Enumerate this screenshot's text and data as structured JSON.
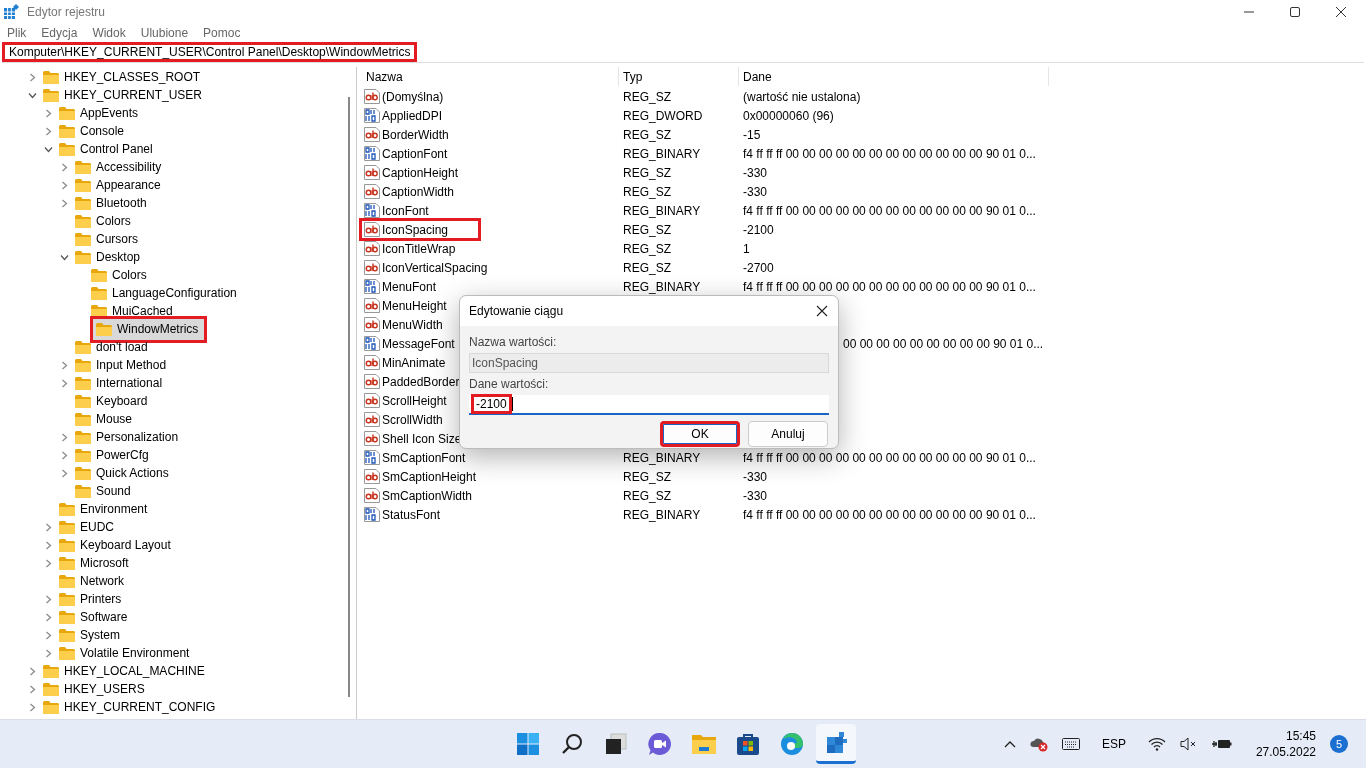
{
  "window": {
    "title": "Edytor rejestru"
  },
  "menu": [
    "Plik",
    "Edycja",
    "Widok",
    "Ulubione",
    "Pomoc"
  ],
  "address": {
    "value": "Komputer\\HKEY_CURRENT_USER\\Control Panel\\Desktop\\WindowMetrics",
    "annotated": true
  },
  "tree": [
    {
      "label": "HKEY_CLASSES_ROOT",
      "expanded": false,
      "selected": false
    },
    {
      "label": "HKEY_CURRENT_USER",
      "expanded": true,
      "selected": false,
      "children": [
        {
          "label": "AppEvents",
          "expanded": false,
          "selected": false
        },
        {
          "label": "Console",
          "expanded": false,
          "selected": false
        },
        {
          "label": "Control Panel",
          "expanded": true,
          "selected": false,
          "children": [
            {
              "label": "Accessibility",
              "expanded": false,
              "selected": false
            },
            {
              "label": "Appearance",
              "expanded": false,
              "selected": false
            },
            {
              "label": "Bluetooth",
              "expanded": false,
              "selected": false
            },
            {
              "label": "Colors",
              "selected": false
            },
            {
              "label": "Cursors",
              "selected": false
            },
            {
              "label": "Desktop",
              "expanded": true,
              "selected": false,
              "children": [
                {
                  "label": "Colors",
                  "selected": false
                },
                {
                  "label": "LanguageConfiguration",
                  "selected": false
                },
                {
                  "label": "MuiCached",
                  "selected": false
                },
                {
                  "label": "WindowMetrics",
                  "selected": true,
                  "annotated": true
                }
              ]
            },
            {
              "label": "don't load",
              "selected": false
            },
            {
              "label": "Input Method",
              "expanded": false,
              "selected": false
            },
            {
              "label": "International",
              "expanded": false,
              "selected": false
            },
            {
              "label": "Keyboard",
              "selected": false
            },
            {
              "label": "Mouse",
              "selected": false
            },
            {
              "label": "Personalization",
              "expanded": false,
              "selected": false
            },
            {
              "label": "PowerCfg",
              "expanded": false,
              "selected": false
            },
            {
              "label": "Quick Actions",
              "expanded": false,
              "selected": false
            },
            {
              "label": "Sound",
              "selected": false
            }
          ]
        },
        {
          "label": "Environment",
          "selected": false
        },
        {
          "label": "EUDC",
          "expanded": false,
          "selected": false
        },
        {
          "label": "Keyboard Layout",
          "expanded": false,
          "selected": false
        },
        {
          "label": "Microsoft",
          "expanded": false,
          "selected": false
        },
        {
          "label": "Network",
          "selected": false
        },
        {
          "label": "Printers",
          "expanded": false,
          "selected": false
        },
        {
          "label": "Software",
          "expanded": false,
          "selected": false
        },
        {
          "label": "System",
          "expanded": false,
          "selected": false
        },
        {
          "label": "Volatile Environment",
          "expanded": false,
          "selected": false
        }
      ]
    },
    {
      "label": "HKEY_LOCAL_MACHINE",
      "expanded": false,
      "selected": false
    },
    {
      "label": "HKEY_USERS",
      "expanded": false,
      "selected": false
    },
    {
      "label": "HKEY_CURRENT_CONFIG",
      "expanded": false,
      "selected": false
    }
  ],
  "values": {
    "columns": [
      "Nazwa",
      "Typ",
      "Dane"
    ],
    "rows": [
      {
        "kind": "string",
        "name": "(Domyślna)",
        "type": "REG_SZ",
        "data": "(wartość nie ustalona)"
      },
      {
        "kind": "binary",
        "name": "AppliedDPI",
        "type": "REG_DWORD",
        "data": "0x00000060 (96)"
      },
      {
        "kind": "string",
        "name": "BorderWidth",
        "type": "REG_SZ",
        "data": "-15"
      },
      {
        "kind": "binary",
        "name": "CaptionFont",
        "type": "REG_BINARY",
        "data": "f4 ff ff ff 00 00 00 00 00 00 00 00 00 00 00 00 90 01 0..."
      },
      {
        "kind": "string",
        "name": "CaptionHeight",
        "type": "REG_SZ",
        "data": "-330"
      },
      {
        "kind": "string",
        "name": "CaptionWidth",
        "type": "REG_SZ",
        "data": "-330"
      },
      {
        "kind": "binary",
        "name": "IconFont",
        "type": "REG_BINARY",
        "data": "f4 ff ff ff 00 00 00 00 00 00 00 00 00 00 00 00 90 01 0..."
      },
      {
        "kind": "string",
        "name": "IconSpacing",
        "type": "REG_SZ",
        "data": "-2100",
        "annotated": true
      },
      {
        "kind": "string",
        "name": "IconTitleWrap",
        "type": "REG_SZ",
        "data": "1"
      },
      {
        "kind": "string",
        "name": "IconVerticalSpacing",
        "type": "REG_SZ",
        "data": "-2700"
      },
      {
        "kind": "binary",
        "name": "MenuFont",
        "type": "REG_BINARY",
        "data": "f4 ff ff ff 00 00 00 00 00 00 00 00 00 00 00 00 90 01 0..."
      },
      {
        "kind": "string",
        "name": "MenuHeight"
      },
      {
        "kind": "string",
        "name": "MenuWidth"
      },
      {
        "kind": "binary",
        "name": "MessageFont",
        "data_tail": "00 00 00 00 00 00 00 00 00 90 01 0..."
      },
      {
        "kind": "string",
        "name": "MinAnimate"
      },
      {
        "kind": "string",
        "name": "PaddedBorder"
      },
      {
        "kind": "string",
        "name": "ScrollHeight"
      },
      {
        "kind": "string",
        "name": "ScrollWidth"
      },
      {
        "kind": "string",
        "name": "Shell Icon Size"
      },
      {
        "kind": "binary",
        "name": "SmCaptionFont",
        "type": "REG_BINARY",
        "data": "f4 ff ff ff 00 00 00 00 00 00 00 00 00 00 00 00 90 01 0..."
      },
      {
        "kind": "string",
        "name": "SmCaptionHeight",
        "type": "REG_SZ",
        "data": "-330"
      },
      {
        "kind": "string",
        "name": "SmCaptionWidth",
        "type": "REG_SZ",
        "data": "-330"
      },
      {
        "kind": "binary",
        "name": "StatusFont",
        "type": "REG_BINARY",
        "data": "f4 ff ff ff 00 00 00 00 00 00 00 00 00 00 00 00 90 01 0..."
      }
    ]
  },
  "dialog": {
    "title": "Edytowanie ciągu",
    "name_label": "Nazwa wartości:",
    "name_value": "IconSpacing",
    "data_label": "Dane wartości:",
    "data_value": "-2100",
    "data_annotated": true,
    "buttons": [
      {
        "label": "OK",
        "default": true,
        "annotated": true
      },
      {
        "label": "Anuluj",
        "default": false,
        "annotated": false
      }
    ]
  },
  "taskbar": {
    "apps": [
      {
        "kind": "start",
        "active": false
      },
      {
        "kind": "search",
        "active": false
      },
      {
        "kind": "taskview",
        "active": false
      },
      {
        "kind": "chat",
        "active": false
      },
      {
        "kind": "explorer",
        "active": false
      },
      {
        "kind": "store",
        "active": false
      },
      {
        "kind": "edge",
        "active": false
      },
      {
        "kind": "regedit",
        "active": true
      }
    ],
    "language": "ESP",
    "time": "15:45",
    "date": "27.05.2022",
    "notifications": "5"
  }
}
